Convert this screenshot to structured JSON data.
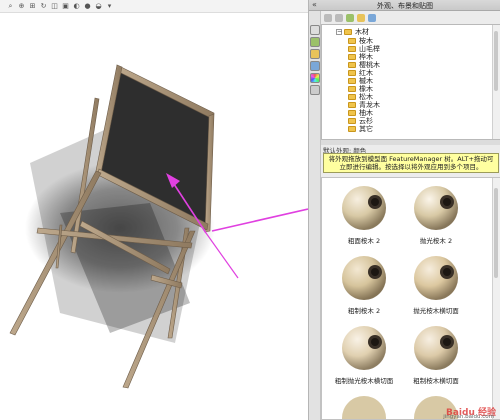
{
  "viewport": {
    "toolbar_icons": [
      "search-icon",
      "zoom-icon",
      "zoom-area-icon",
      "rotate-icon",
      "section-view-icon",
      "display-style-icon",
      "hide-show-icon",
      "appearance-icon",
      "scene-icon",
      "settings-icon"
    ]
  },
  "taskpane": {
    "title": "外观、布景和贴图",
    "collapse_glyph": "«",
    "side_tabs": [
      "home-tab-icon",
      "design-library-tab-icon",
      "file-explorer-tab-icon",
      "search-tab-icon",
      "appearance-tab-icon",
      "custom-tab-icon"
    ],
    "tree": {
      "expander": "−",
      "root": "木材",
      "items": [
        "桉木",
        "山毛榉",
        "桦木",
        "樱桃木",
        "红木",
        "槭木",
        "橡木",
        "松木",
        "青龙木",
        "柚木",
        "云杉",
        "其它"
      ]
    },
    "section_label": "默认外观: 颜色",
    "tooltip": "将外观拖放到模型面 FeatureManager 树。ALT+拖动可立即进行编辑。按选择以将外观应用到多个项目。",
    "swatches": [
      {
        "label": "粗面桉木 2",
        "color": "#d8c9a5"
      },
      {
        "label": "抛光桉木 2",
        "color": "#d8c9a5"
      },
      {
        "label": "粗制桉木 2",
        "color": "#d6c49c"
      },
      {
        "label": "抛光桉木横切面",
        "color": "#dcc8a0"
      },
      {
        "label": "粗制抛光桉木横切面",
        "color": "#e0d0b0"
      },
      {
        "label": "粗制桉木横切面",
        "color": "#dccaa8"
      }
    ],
    "watermark": "Baidu 经验",
    "watermark_url": "jingyan.baidu.com"
  },
  "colors": {
    "frame": "#a18c72",
    "frame_edge": "#6e5d49",
    "board": "#2e2e2e",
    "arrow": "#e040e0",
    "shadow": "#2a2a2a"
  }
}
